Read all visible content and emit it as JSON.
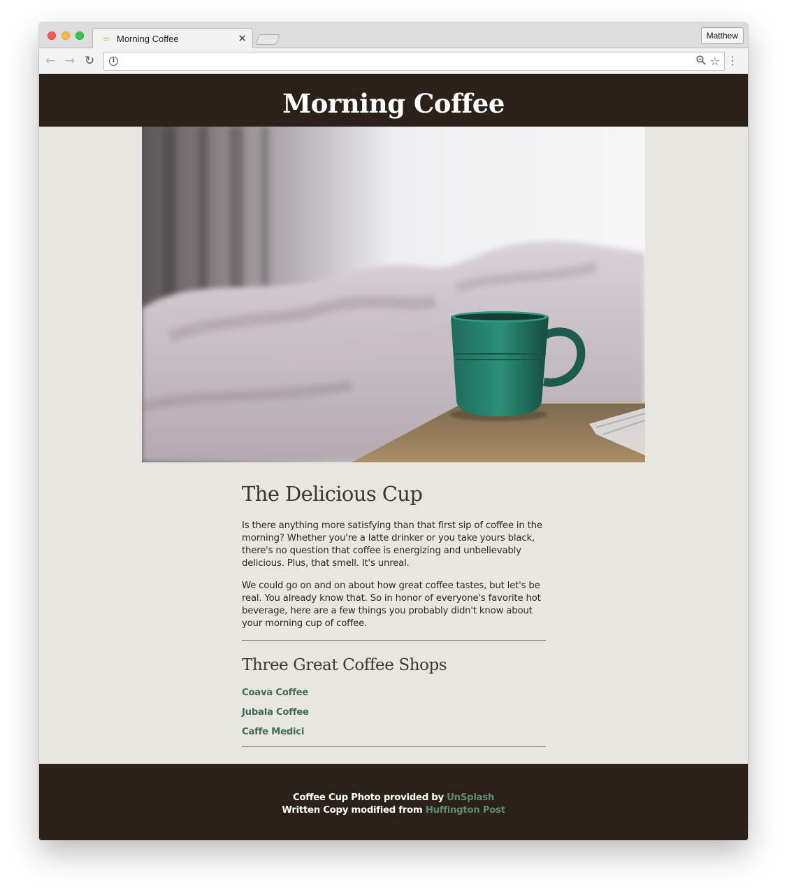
{
  "browser": {
    "tab_title": "Morning Coffee",
    "tab_close": "✕",
    "profile_name": "Matthew"
  },
  "site": {
    "title": "Morning Coffee"
  },
  "article": {
    "heading": "The Delicious Cup",
    "paragraphs": [
      "Is there anything more satisfying than that first sip of coffee in the morning? Whether you're a latte drinker or you take yours black, there's no question that coffee is energizing and unbelievably delicious. Plus, that smell. It's unreal.",
      "We could go on and on about how great coffee tastes, but let's be real. You already know that. So in honor of everyone's favorite hot beverage, here are a few things you probably didn't know about your morning cup of coffee."
    ]
  },
  "shops": {
    "heading": "Three Great Coffee Shops",
    "items": [
      "Coava Coffee",
      "Jubala Coffee",
      "Caffe Medici"
    ]
  },
  "footer": {
    "line1_text": "Coffee Cup Photo provided by",
    "line1_link": "UnSplash",
    "line2_text": "Written Copy modified from",
    "line2_link": "Huffington Post"
  },
  "icons": {
    "favicon": "coffee-favicon",
    "back": "back-arrow-icon",
    "forward": "forward-arrow-icon",
    "reload": "reload-icon",
    "info": "info-icon",
    "zoom": "zoom-icon",
    "star": "bookmark-star-icon",
    "menu": "kebab-menu-icon"
  },
  "colors": {
    "masthead_bg": "#2b2118",
    "page_bg": "#e8e6e1",
    "link": "#3f6b5a",
    "footer_link": "#5f8b76"
  }
}
